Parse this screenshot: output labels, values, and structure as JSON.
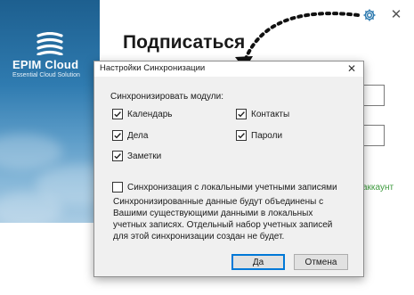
{
  "app": {
    "brand_name": "EPIM Cloud",
    "brand_tagline": "Essential Cloud Solution",
    "heading": "Подписаться",
    "link_fragment": "аккаунт",
    "close_glyph": "✕"
  },
  "dialog": {
    "title": "Настройки Синхронизации",
    "close_glyph": "✕",
    "modules_label": "Синхронизировать модули:",
    "modules": [
      {
        "label": "Календарь",
        "checked": true
      },
      {
        "label": "Контакты",
        "checked": true
      },
      {
        "label": "Дела",
        "checked": true
      },
      {
        "label": "Пароли",
        "checked": true
      },
      {
        "label": "Заметки",
        "checked": true
      }
    ],
    "local_sync": {
      "label": "Синхронизация с локальными учетными записями",
      "checked": false
    },
    "description": "Синхронизированные данные будут объединены с Вашими существующими данными в локальных учетных записях. Отдельный набор учетных записей для этой синхронизации создан не будет.",
    "ok_label": "Да",
    "cancel_label": "Отмена"
  },
  "colors": {
    "brand_blue": "#2f7bb0",
    "link_green": "#3d9a3d",
    "accent_blue": "#0078d7"
  },
  "icons": {
    "settings": "gear-icon",
    "close": "close-icon",
    "logo": "epim-logo-icon",
    "check": "checkmark-icon"
  }
}
